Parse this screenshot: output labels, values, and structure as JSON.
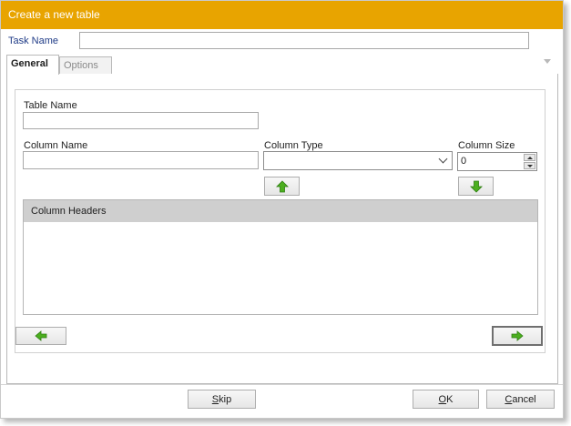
{
  "window": {
    "title": "Create  a new table"
  },
  "task": {
    "label": "Task Name",
    "value": ""
  },
  "tabs": [
    {
      "label": "General",
      "active": true
    },
    {
      "label": "Options",
      "active": false
    }
  ],
  "form": {
    "table_name_label": "Table Name",
    "table_name_value": "",
    "column_name_label": "Column Name",
    "column_name_value": "",
    "column_type_label": "Column Type",
    "column_type_value": "",
    "column_size_label": "Column Size",
    "column_size_value": "0"
  },
  "list": {
    "header": "Column Headers",
    "rows": []
  },
  "footer": {
    "skip_mnemonic": "S",
    "skip_rest": "kip",
    "ok_mnemonic": "O",
    "ok_rest": "K",
    "cancel_mnemonic": "C",
    "cancel_rest": "ancel"
  },
  "colors": {
    "titlebar": "#e8a400",
    "arrow_green": "#4caf1f",
    "label_blue": "#1f3b87"
  },
  "icons": {
    "move_up": "green-arrow-up-icon",
    "move_down": "green-arrow-down-icon",
    "back": "green-arrow-left-icon",
    "next": "green-arrow-right-icon"
  }
}
